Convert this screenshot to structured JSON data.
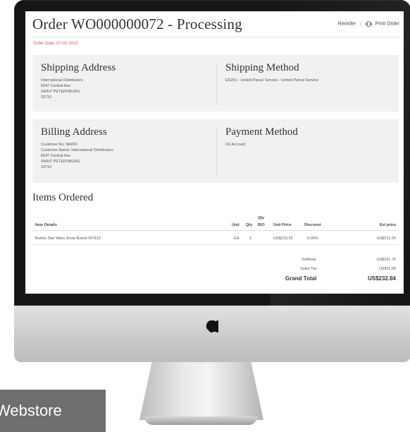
{
  "order": {
    "title": "Order WO000000072 - Processing",
    "date": "Order Date: 07-02-2015",
    "reorder_label": "Reorder",
    "separator": "|",
    "print_label": "Print Order"
  },
  "shipping_address": {
    "heading": "Shipping Address",
    "lines": [
      "International Distributors",
      "6647 Central Ave",
      "SAINT PETERSBURG",
      "33710"
    ]
  },
  "shipping_method": {
    "heading": "Shipping Method",
    "lines": [
      "ES201 - United Parcel Service - United Parcel Service"
    ]
  },
  "billing_address": {
    "heading": "Billing Address",
    "lines": [
      "Customer No: NA001",
      "Customer Name: International Distributors",
      "6647 Central Ave",
      "SAINT PETERSBURG",
      "33710"
    ]
  },
  "payment_method": {
    "heading": "Payment Method",
    "lines": [
      "On Account"
    ]
  },
  "items": {
    "heading": "Items Ordered",
    "columns": {
      "item_details": "Item Details",
      "unit": "Unit",
      "qty": "Qty",
      "qty_bo_top": "Qty",
      "qty_bo_bottom": "B/O",
      "unit_price": "Unit Price",
      "discount": "Discount",
      "ext_price": "Ext price"
    },
    "rows": [
      {
        "item": "Burton Star Wars Snow Board SF!813",
        "unit": "EA",
        "qty": "1",
        "qty_bo": "",
        "unit_price": "US$213.25",
        "discount": "0.00%",
        "ext_price": "US$213.25"
      }
    ]
  },
  "totals": {
    "subtotal_label": "Subtotal",
    "subtotal_value": "US$221.75",
    "tax_label": "Sales Tax",
    "tax_value": "US$11.09",
    "grand_label": "Grand Total",
    "grand_value": "US$232.84"
  },
  "footer_label": "Webstore",
  "colors": {
    "order_date": "#d9534f",
    "panel_bg": "#f1f1f1",
    "label_bg": "#6d6e70"
  },
  "icons": {
    "print": "printer-icon",
    "device_logo": "apple-logo-icon"
  }
}
